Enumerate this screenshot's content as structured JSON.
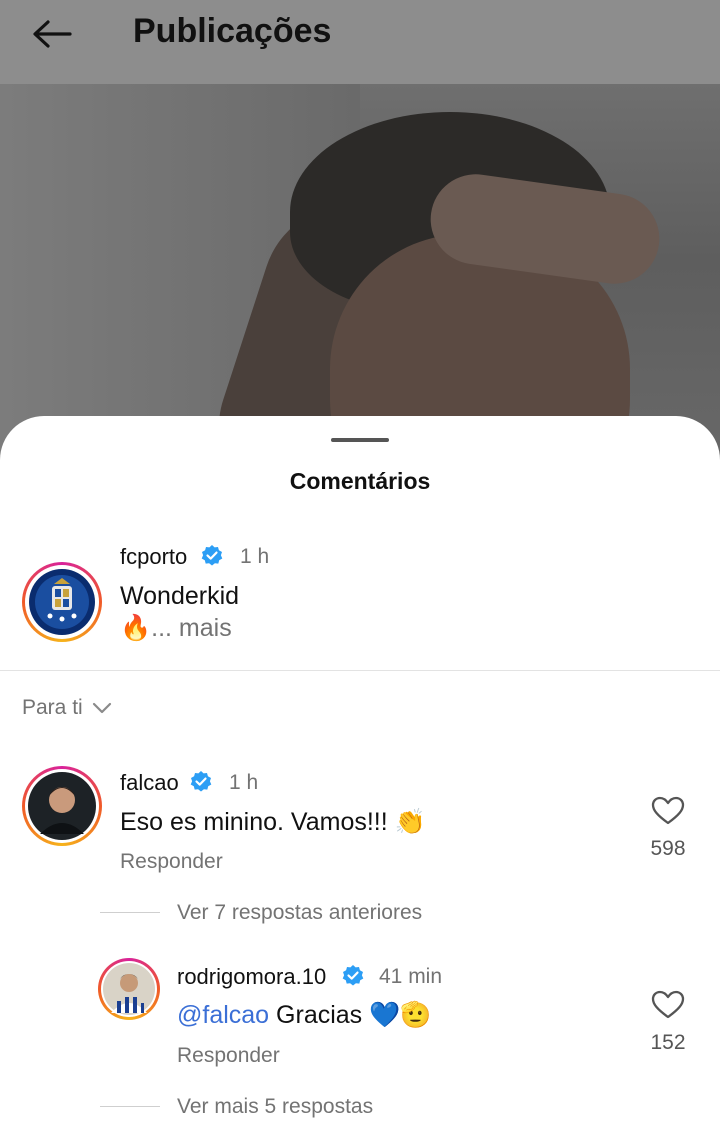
{
  "header": {
    "title": "Publicações",
    "back_icon": "arrow-left-icon"
  },
  "sheet": {
    "title": "Comentários"
  },
  "caption": {
    "username": "fcporto",
    "verified": true,
    "time": "1 h",
    "text": "Wonderkid",
    "emoji": "🔥",
    "more": "... mais",
    "avatar_icon": "fc-porto-crest-icon"
  },
  "filter": {
    "label": "Para ti",
    "icon": "chevron-down-icon"
  },
  "comments": [
    {
      "username": "falcao",
      "verified": true,
      "time": "1 h",
      "text": "Eso es minino. Vamos!!!",
      "emoji": "👏",
      "reply_label": "Responder",
      "likes": "598",
      "thread_link": "Ver 7 respostas anteriores"
    }
  ],
  "reply": {
    "username": "rodrigomora.10",
    "verified": true,
    "time": "41 min",
    "mention": "@falcao",
    "text": "Gracias",
    "emoji": "💙🫡",
    "reply_label": "Responder",
    "likes": "152",
    "thread_link": "Ver mais 5 respostas"
  },
  "colors": {
    "verified_blue": "#2c9ef5",
    "mention_blue": "#3b6fd6",
    "muted_gray": "#737373"
  }
}
